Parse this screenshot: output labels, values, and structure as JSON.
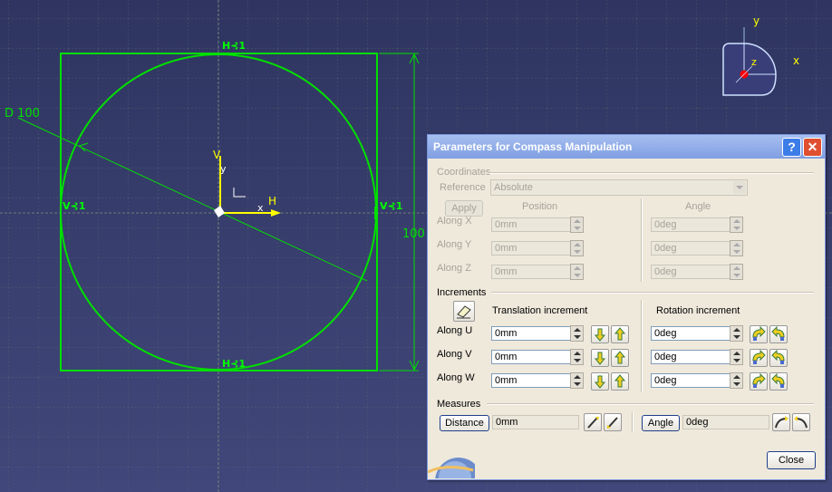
{
  "sketch": {
    "diameter_label": "D 100",
    "dimension_label": "100",
    "constraint_h": "H",
    "constraint_v": "V",
    "axis_h": "H",
    "axis_v": "V",
    "axis_x": "x",
    "axis_y": "y"
  },
  "compass": {
    "x": "x",
    "y": "y",
    "z": "z"
  },
  "dialog": {
    "title": "Parameters for Compass Manipulation",
    "help_button": "?",
    "close_x": "✕",
    "coordinates": {
      "section_label": "Coordinates",
      "reference_label": "Reference",
      "reference_value": "Absolute",
      "apply_label": "Apply",
      "position_header": "Position",
      "angle_header": "Angle",
      "rows": [
        {
          "label": "Along X",
          "position": "0mm",
          "angle": "0deg"
        },
        {
          "label": "Along Y",
          "position": "0mm",
          "angle": "0deg"
        },
        {
          "label": "Along Z",
          "position": "0mm",
          "angle": "0deg"
        }
      ]
    },
    "increments": {
      "section_label": "Increments",
      "translation_header": "Translation increment",
      "rotation_header": "Rotation increment",
      "rows": [
        {
          "label": "Along U",
          "translation": "0mm",
          "rotation": "0deg"
        },
        {
          "label": "Along V",
          "translation": "0mm",
          "rotation": "0deg"
        },
        {
          "label": "Along W",
          "translation": "0mm",
          "rotation": "0deg"
        }
      ]
    },
    "measures": {
      "section_label": "Measures",
      "distance_label": "Distance",
      "distance_value": "0mm",
      "angle_label": "Angle",
      "angle_value": "0deg"
    },
    "close_label": "Close"
  },
  "colors": {
    "background": "#363c6c",
    "sketch_green": "#00e000",
    "axis_yellow": "#ffff00",
    "title_blue": "#7f9ee2",
    "dialog_bg": "#efe9dc"
  }
}
